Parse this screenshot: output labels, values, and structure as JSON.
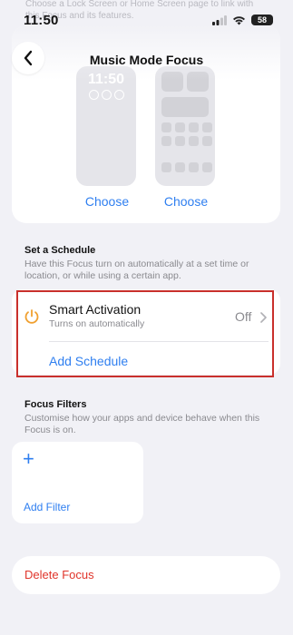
{
  "status": {
    "time": "11:50",
    "battery": "58"
  },
  "header": {
    "title": "Music Mode Focus",
    "faded_description": "Choose a Lock Screen or Home Screen page to link with this Focus and its features."
  },
  "preview": {
    "lock_time": "11:50",
    "choose_left": "Choose",
    "choose_right": "Choose"
  },
  "schedule": {
    "title": "Set a Schedule",
    "description": "Have this Focus turn on automatically at a set time or location, or while using a certain app.",
    "smart_activation": {
      "label": "Smart Activation",
      "sub": "Turns on automatically",
      "value": "Off"
    },
    "add_schedule": "Add Schedule"
  },
  "filters": {
    "title": "Focus Filters",
    "description": "Customise how your apps and device behave when this Focus is on.",
    "add_filter": "Add Filter",
    "plus": "+"
  },
  "delete_label": "Delete Focus",
  "colors": {
    "accent": "#2f7ff0",
    "destructive": "#e0342a",
    "highlight": "#c9302c",
    "activation_icon": "#f0a030"
  }
}
